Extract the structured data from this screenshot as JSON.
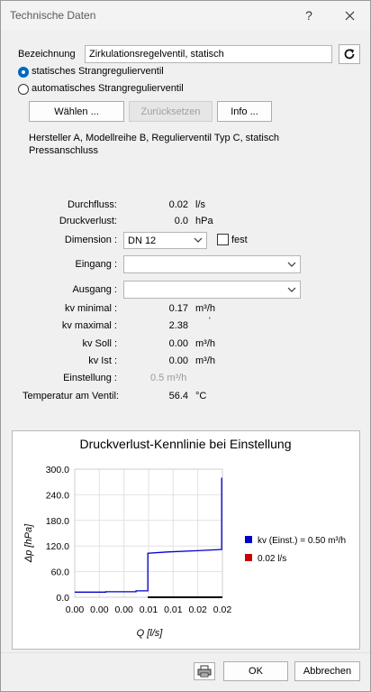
{
  "window": {
    "title": "Technische Daten",
    "help": "?",
    "close": "✕"
  },
  "bezeichnung": {
    "label": "Bezeichnung",
    "value": "Zirkulationsregelventil, statisch",
    "refresh_icon": "refresh-icon"
  },
  "radios": [
    {
      "label": "statisches Strangregulierventil",
      "selected": true
    },
    {
      "label": "automatisches Strangregulierventil",
      "selected": false
    }
  ],
  "buttons": {
    "waehlen": "Wählen ...",
    "zuruecksetzen": "Zurücksetzen",
    "info": "Info ..."
  },
  "description": {
    "line1": "Hersteller A, Modellreihe B, Regulierventil Typ C, statisch",
    "line2": "Pressanschluss"
  },
  "fields": {
    "durchfluss": {
      "label": "Durchfluss:",
      "value": "0.02",
      "unit": "l/s"
    },
    "druckverlust": {
      "label": "Druckverlust:",
      "value": "0.0",
      "unit": "hPa"
    },
    "dimension": {
      "label": "Dimension :",
      "value": "DN 12",
      "fest_label": "fest",
      "fest_checked": false
    },
    "eingang": {
      "label": "Eingang :",
      "value": ""
    },
    "ausgang": {
      "label": "Ausgang :",
      "value": ""
    },
    "kv_min": {
      "label": "kv minimal :",
      "value": "0.17",
      "unit": "m³/h"
    },
    "kv_max": {
      "label": "kv maximal :",
      "value": "2.38",
      "unit": "'"
    },
    "kv_soll": {
      "label": "kv Soll :",
      "value": "0.00",
      "unit": "m³/h"
    },
    "kv_ist": {
      "label": "kv Ist :",
      "value": "0.00",
      "unit": "m³/h"
    },
    "einstellung": {
      "label": "Einstellung :",
      "value": "0.5 m³/h"
    },
    "temperatur": {
      "label": "Temperatur am Ventil:",
      "value": "56.4",
      "unit": "°C"
    }
  },
  "chart_data": {
    "type": "line",
    "title": "Druckverlust-Kennlinie bei Einstellung",
    "xlabel": "Q [l/s]",
    "ylabel": "Δp [hPa]",
    "xlim": [
      0,
      0.02
    ],
    "ylim": [
      0,
      300
    ],
    "x_tick_labels": [
      "0.00",
      "0.00",
      "0.00",
      "0.01",
      "0.01",
      "0.02",
      "0.02"
    ],
    "y_tick_labels": [
      "300.0",
      "240.0",
      "180.0",
      "120.0",
      "60.0",
      "0.0"
    ],
    "grid": true,
    "legend_placement": "right",
    "series": [
      {
        "name": "kv (Einst.) = 0.50 m³/h",
        "color": "#0000cc",
        "x": [
          0.0,
          0.0042,
          0.0042,
          0.0083,
          0.0083,
          0.0099,
          0.0099,
          0.0125,
          0.0166,
          0.0199,
          0.0199
        ],
        "y": [
          12,
          12,
          13,
          13,
          15,
          15,
          103,
          106,
          109,
          112,
          280
        ]
      },
      {
        "name": "0.02 l/s",
        "color": "#cc0000",
        "x": [
          0.0099,
          0.0099,
          0.02
        ],
        "y": [
          0,
          0,
          0
        ]
      }
    ]
  },
  "footer": {
    "print_icon": "printer-icon",
    "ok": "OK",
    "cancel": "Abbrechen"
  }
}
